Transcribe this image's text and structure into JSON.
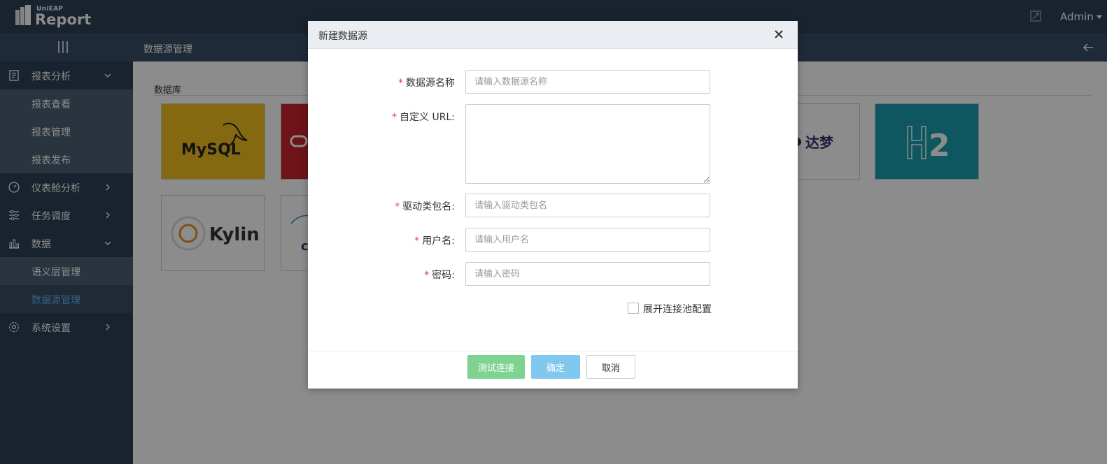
{
  "header": {
    "logo_small": "UniEAP",
    "logo_big": "Report",
    "user": "Admin"
  },
  "subbar": {
    "breadcrumb": "数据源管理"
  },
  "sidebar": {
    "items": [
      {
        "label": "报表分析",
        "icon": "report-icon",
        "arrow": "down"
      },
      {
        "label": "报表查看",
        "sub": true
      },
      {
        "label": "报表管理",
        "sub": true
      },
      {
        "label": "报表发布",
        "sub": true
      },
      {
        "label": "仪表舱分析",
        "icon": "dashboard-icon",
        "arrow": "right"
      },
      {
        "label": "任务调度",
        "icon": "sliders-icon",
        "arrow": "right"
      },
      {
        "label": "数据",
        "icon": "bar-chart-icon",
        "arrow": "down"
      },
      {
        "label": "语义层管理",
        "sub": true
      },
      {
        "label": "数据源管理",
        "sub": true,
        "active": true
      },
      {
        "label": "系统设置",
        "icon": "gear-icon",
        "arrow": "right"
      }
    ]
  },
  "content": {
    "section_title": "数据库",
    "cards": [
      {
        "name": "MySQL",
        "bg": "#f2bf1e"
      },
      {
        "name": "Oracle",
        "bg": "#c8242c"
      },
      {
        "name": "达梦",
        "bg": "#ffffff"
      },
      {
        "name": "H2",
        "bg": "#1a9eb0"
      },
      {
        "name": "Kylin",
        "bg": "#ffffff"
      },
      {
        "name": "ClickHouse",
        "bg": "#ffffff"
      }
    ]
  },
  "modal": {
    "title": "新建数据源",
    "fields": {
      "name": {
        "label": "数据源名称",
        "placeholder": "请输入数据源名称"
      },
      "url": {
        "label": "自定义 URL:",
        "placeholder": ""
      },
      "driver": {
        "label": "驱动类包名:",
        "placeholder": "请输入驱动类包名"
      },
      "username": {
        "label": "用户名:",
        "placeholder": "请输入用户名"
      },
      "password": {
        "label": "密码:",
        "placeholder": "请输入密码"
      }
    },
    "pool_label": "展开连接池配置",
    "buttons": {
      "test": "测试连接",
      "ok": "确定",
      "cancel": "取消"
    }
  },
  "colors": {
    "topbar": "#2f4056",
    "accent": "#5fb3f5",
    "required": "#e0463a",
    "test_button": "#7dd38f",
    "ok_button": "#80c8f0"
  }
}
